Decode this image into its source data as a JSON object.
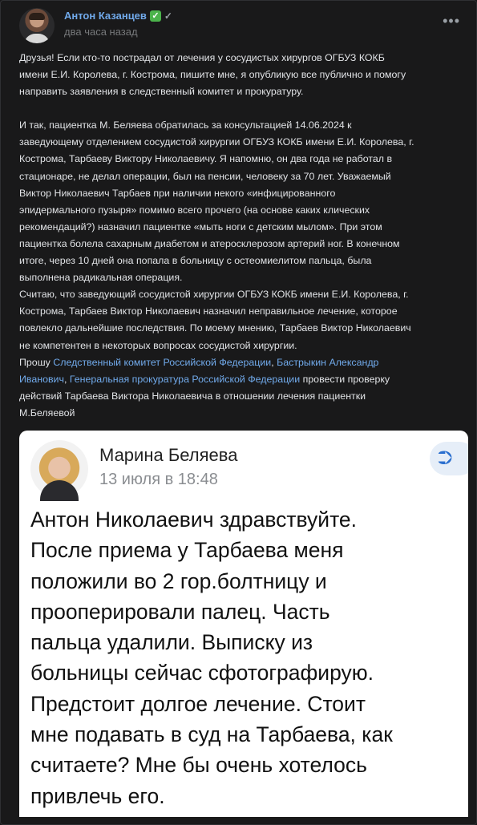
{
  "post": {
    "author": "Антон Казанцев",
    "time": "два часа назад",
    "paragraphs": [
      [
        "Друзья! Если кто-то пострадал от лечения у сосудистых хирургов ОГБУЗ КОКБ",
        "имени Е.И. Королева, г. Кострома, пишите мне, я опубликую все публично и помогу",
        "направить заявления в следственный комитет и прокуратуру."
      ],
      [
        "И так, пациентка М. Беляева обратилась за консультацией 14.06.2024 к",
        "заведующему отделением сосудистой хирургии ОГБУЗ КОКБ имени Е.И. Королева, г.",
        "Кострома, Тарбаеву Виктору Николаевичу. Я напомню, он два года не работал в",
        "стационаре, не делал операции, был на пенсии, человеку за 70 лет. Уважаемый",
        "Виктор Николаевич Тарбаев при наличии некого «инфицированного",
        "эпидермального пузыря» помимо всего прочего (на основе каких клических",
        "рекомендаций?) назначил пациентке «мыть ноги с детским мылом». При этом",
        "пациентка болела сахарным диабетом и атеросклерозом артерий ног. В конечном",
        "итоге, через 10 дней она попала в больницу с остеомиелитом пальца, была",
        "выполнена радикальная операция."
      ],
      [
        "Считаю, что заведующий сосудистой хирургии ОГБУЗ КОКБ имени Е.И. Королева, г.",
        "Кострома, Тарбаев Виктор Николаевич назначил неправильное лечение, которое",
        "повлекло дальнейшие последствия. По моему мнению, Тарбаев Виктор Николаевич",
        "не компетентен в некоторых вопросах сосудистой хирургии."
      ]
    ],
    "request": {
      "prefix": "Прошу ",
      "link1": "Следственный комитет Российской Федерации",
      "sep1": ", ",
      "link2a": "Бастрыкин Александр",
      "link2b": "Иванович",
      "sep2": ", ",
      "link3": "Генеральная прокуратура Российской Федерации",
      "suffix": " провести проверку",
      "line3": "действий Тарбаева Виктора Николаевича в отношении лечения пациентки",
      "line4": "М.Беляевой"
    }
  },
  "screenshot": {
    "name": "Марина Беляева",
    "date": "13 июля в 18:48",
    "icon": "reply-arrow-icon",
    "message_lines": [
      "Антон Николаевич здравствуйте.",
      "После приема у Тарбаева меня",
      "положили во 2 гор.болтницу и",
      "прооперировали палец. Часть",
      "пальца удалили. Выписку из",
      "больницы сейчас сфотографирую.",
      "Предстоит долгое лечение. Стоит",
      "мне подавать в суд на Тарбаева, как",
      "считаете? Мне бы очень хотелось",
      "привлечь его."
    ]
  }
}
